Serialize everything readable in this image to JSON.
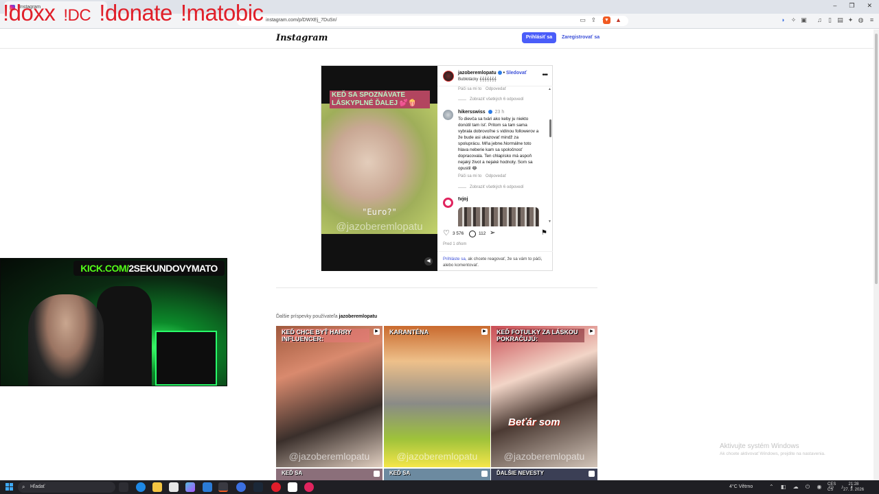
{
  "overlay": {
    "cmd1": "!doxx",
    "cmd2": "!DC",
    "cmd3": "!donate",
    "cmd4": "!matobic"
  },
  "browser": {
    "tab_title": "Instagram",
    "url": "instagram.com/p/DWXEj_7DuSn/",
    "window_controls": [
      "–",
      "❐",
      "✕"
    ]
  },
  "instagram": {
    "logo": "Instagram",
    "login_button": "Prihlásiť sa",
    "register_link": "Zaregistrovať sa"
  },
  "post": {
    "media": {
      "caption": "KEĎ SA SPOZNÁVATE LÁSKYPLNÉ ĎALEJ 💕🍿",
      "quote": "\"Euro?\"",
      "watermark": "@jazoberemlopatu"
    },
    "header": {
      "username": "jazoberemlopatu",
      "separator": "•",
      "follow": "Sledovať",
      "subtitle": "Bublotácky 𝄞𝄞𝄞𝄞𝄞𝄞𝄞"
    },
    "comments": {
      "like_reply_top": "Páči sa mi to",
      "reply_top": "Odpovedať",
      "view_replies_1": "Zobraziť všetkých 6 odpovedí",
      "c1_user": "hikersswiss",
      "c1_time": "23 h",
      "c1_text": "To dievča sa tvári ako keby ju niekto donútil tam ísť. Pritom sa tam sama vybrala dobrovoľne s vidinou followerov a že bude asi ukazovať mindž za spoluprácu. Mňa jebne.Normálne toto hlava neberie kam sa spoločnosť dopracovala. Ten chlapísko má aspoň nejaký život a nejaké hodnoty. Som sa opustil 😂",
      "c1_like": "Páči sa mi to",
      "c1_reply": "Odpovedať",
      "view_replies_2": "Zobraziť všetkých 6 odpovedí",
      "c2_user": "tvjoj"
    },
    "likes": "3 576",
    "comment_count": "112",
    "age": "Pred 1 dňom",
    "footer_link": "Prihláste sa,",
    "footer_text": " ak chcete reagovať, že sa vám to páči, alebo komentovať."
  },
  "more_posts": {
    "title_prefix": "Ďalšie príspevky používateľa ",
    "title_user": "jazoberemlopatu",
    "items": [
      {
        "caption": "KEĎ CHCE BYŤ HARRY INFLUENCER:",
        "watermark": "@jazoberemlopatu"
      },
      {
        "caption": "KARANTÉNA",
        "watermark": "@jazoberemlopatu"
      },
      {
        "caption": "KEĎ FOTULKY ZA LÁSKOU POKRAČUJÚ:",
        "watermark": "@jazoberemlopatu",
        "overlay": "Beťár som"
      }
    ],
    "row2": [
      "KEĎ SA",
      "KEĎ SA",
      "ĎALŠIE NEVESTY"
    ]
  },
  "windows": {
    "activate_title": "Aktivujte systém Windows",
    "activate_sub": "Ak chcete aktivovať Windows, prejdite na nastavenia.",
    "search": "Hľadať",
    "weather": "4°C Větrno",
    "lang_1": "CES",
    "lang_2": "CS",
    "time": "21:28",
    "date": "27. 3. 2026"
  },
  "webcam": {
    "banner_kick": "KICK.COM/",
    "banner_name": "2SEKUNDOVYMATO"
  }
}
